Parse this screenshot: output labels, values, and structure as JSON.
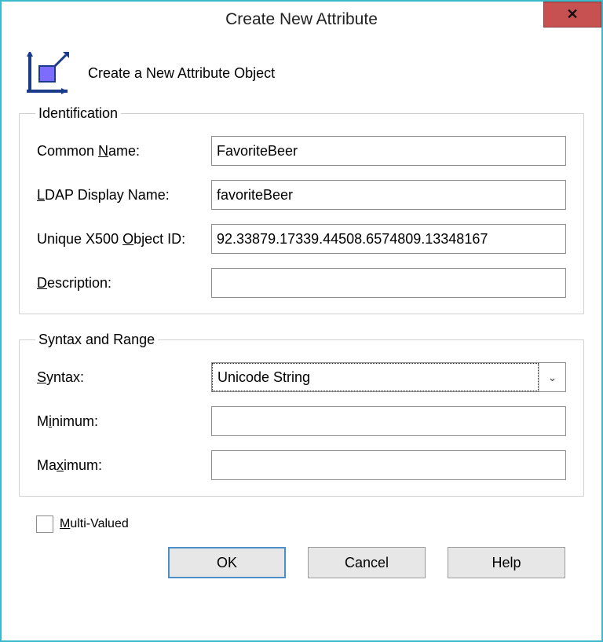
{
  "window": {
    "title": "Create New Attribute"
  },
  "header": {
    "text": "Create a New Attribute Object"
  },
  "identification": {
    "legend": "Identification",
    "common_name_label_pre": "Common ",
    "common_name_label_u": "N",
    "common_name_label_post": "ame:",
    "common_name_value": "FavoriteBeer",
    "ldap_label_u": "L",
    "ldap_label_post": "DAP Display Name:",
    "ldap_value": "favoriteBeer",
    "x500_label_pre": "Unique X500 ",
    "x500_label_u": "O",
    "x500_label_post": "bject ID:",
    "x500_value": "92.33879.17339.44508.6574809.13348167",
    "desc_label_u": "D",
    "desc_label_post": "escription:",
    "desc_value": ""
  },
  "syntax_range": {
    "legend": "Syntax and Range",
    "syntax_label_u": "S",
    "syntax_label_post": "yntax:",
    "syntax_value": "Unicode String",
    "min_label_pre": "M",
    "min_label_u": "i",
    "min_label_post": "nimum:",
    "min_value": "",
    "max_label_pre": "Ma",
    "max_label_u": "x",
    "max_label_post": "imum:",
    "max_value": ""
  },
  "multi_valued": {
    "label_u": "M",
    "label_post": "ulti-Valued",
    "checked": false
  },
  "buttons": {
    "ok": "OK",
    "cancel": "Cancel",
    "help": "Help"
  }
}
